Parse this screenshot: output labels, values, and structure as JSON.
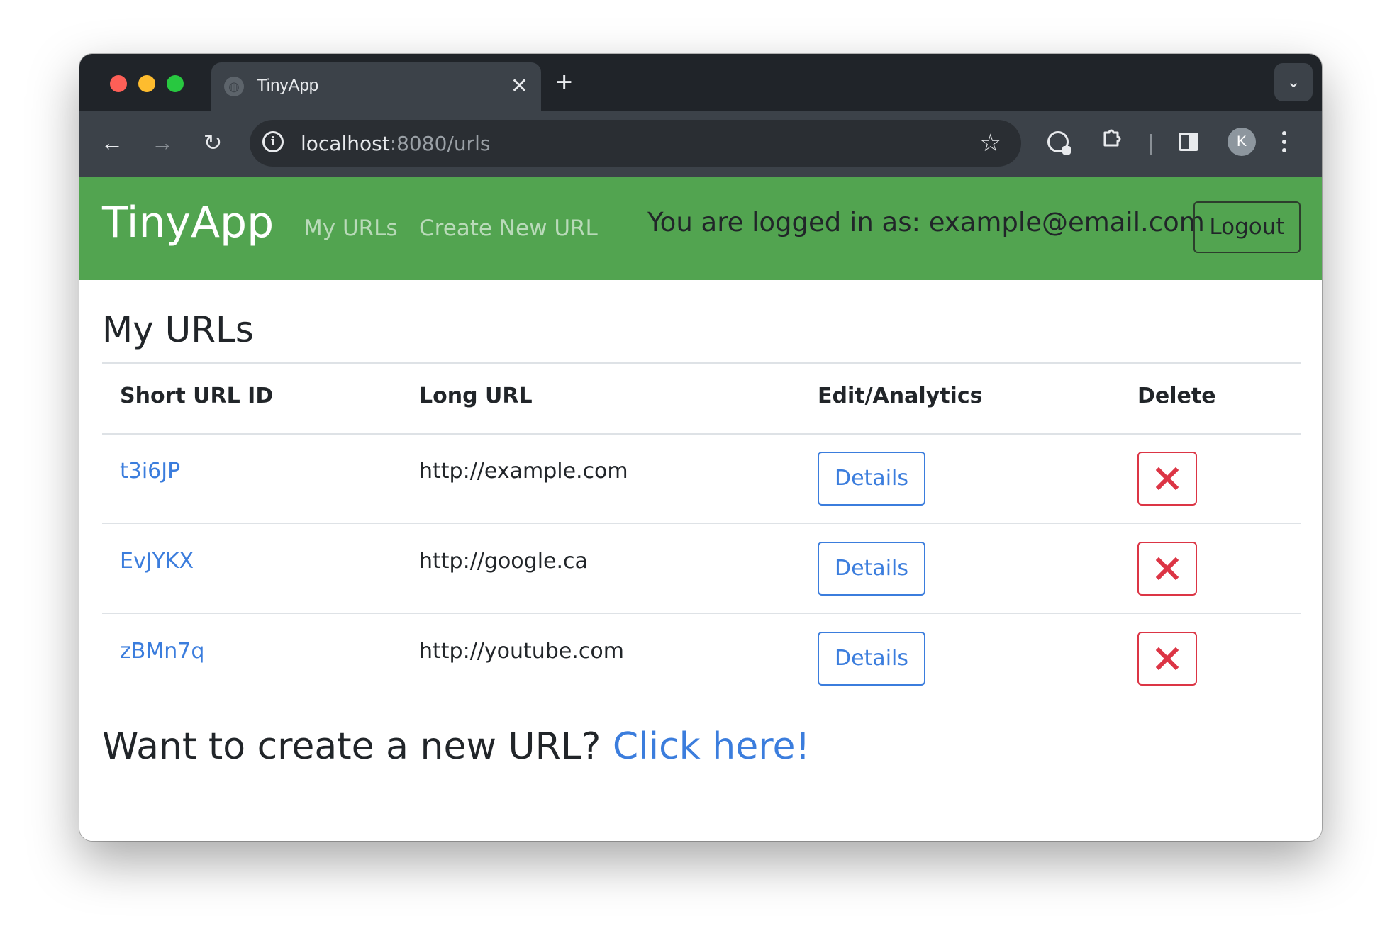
{
  "browser": {
    "tab_title": "TinyApp",
    "new_tab_label": "+",
    "url_host": "localhost",
    "url_path": ":8080/urls",
    "profile_initial": "K"
  },
  "navbar": {
    "brand": "TinyApp",
    "links": [
      "My URLs",
      "Create New URL"
    ],
    "logged_in_text": "You are logged in as: example@email.com",
    "logout_label": "Logout",
    "color": "#52a450"
  },
  "main": {
    "title": "My URLs",
    "table": {
      "headers": [
        "Short URL ID",
        "Long URL",
        "Edit/Analytics",
        "Delete"
      ],
      "rows": [
        {
          "short_id": "t3i6JP",
          "long_url": "http://example.com",
          "details_label": "Details"
        },
        {
          "short_id": "EvJYKX",
          "long_url": "http://google.ca",
          "details_label": "Details"
        },
        {
          "short_id": "zBMn7q",
          "long_url": "http://youtube.com",
          "details_label": "Details"
        }
      ]
    },
    "footer_prompt": "Want to create a new URL?",
    "footer_link": "Click here!"
  },
  "colors": {
    "link_blue": "#3b7ddd",
    "delete_red": "#dc3545",
    "browser_dark": "#202429",
    "toolbar": "#3c4249"
  },
  "icons": {
    "tab_favicon": "globe-icon",
    "tab_close": "close-icon",
    "back": "arrow-left-icon",
    "forward": "arrow-right-icon",
    "reload": "reload-icon",
    "site_info": "info-icon",
    "bookmark": "star-icon",
    "extensions": "puzzle-icon",
    "side_panel": "side-panel-icon",
    "menu": "kebab-menu-icon",
    "delete": "x-icon"
  }
}
